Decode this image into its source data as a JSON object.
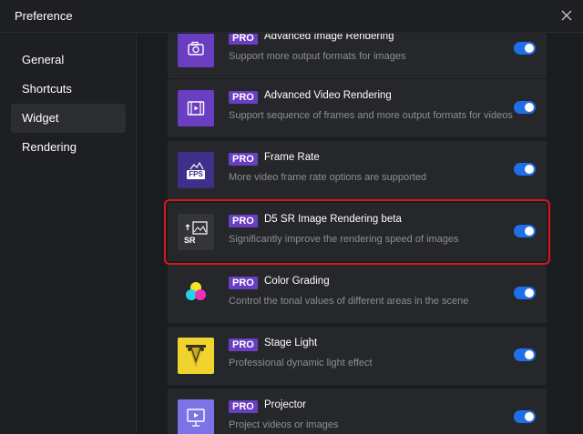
{
  "window": {
    "title": "Preference"
  },
  "sidebar": {
    "items": [
      {
        "label": "General",
        "active": false
      },
      {
        "label": "Shortcuts",
        "active": false
      },
      {
        "label": "Widget",
        "active": true
      },
      {
        "label": "Rendering",
        "active": false
      }
    ]
  },
  "colors": {
    "accent_toggle": "#1f6fe8",
    "pro_badge": "#6a3ec2",
    "highlight_border": "#d9161c"
  },
  "widgets": [
    {
      "badge": "PRO",
      "title": "Advanced Image Rendering",
      "description": "Support more output formats for images",
      "icon": "camera-icon",
      "enabled": true
    },
    {
      "badge": "PRO",
      "title": "Advanced Video Rendering",
      "description": "Support sequence of frames and more output formats for videos",
      "icon": "film-icon",
      "enabled": true
    },
    {
      "badge": "PRO",
      "title": "Frame Rate",
      "description": "More video frame rate options are supported",
      "icon": "fps-icon",
      "icon_text": "FPS",
      "enabled": true
    },
    {
      "badge": "PRO",
      "title": "D5 SR Image Rendering beta",
      "description": "Significantly improve the rendering speed of images",
      "icon": "sr-image-icon",
      "icon_text": "SR",
      "enabled": true,
      "highlighted": true
    },
    {
      "badge": "PRO",
      "title": "Color Grading",
      "description": "Control the tonal values of different areas in the scene",
      "icon": "color-grading-icon",
      "enabled": true
    },
    {
      "badge": "PRO",
      "title": "Stage Light",
      "description": "Professional dynamic light effect",
      "icon": "stage-light-icon",
      "enabled": true
    },
    {
      "badge": "PRO",
      "title": "Projector",
      "description": "Project videos or images",
      "icon": "projector-icon",
      "enabled": true
    }
  ]
}
